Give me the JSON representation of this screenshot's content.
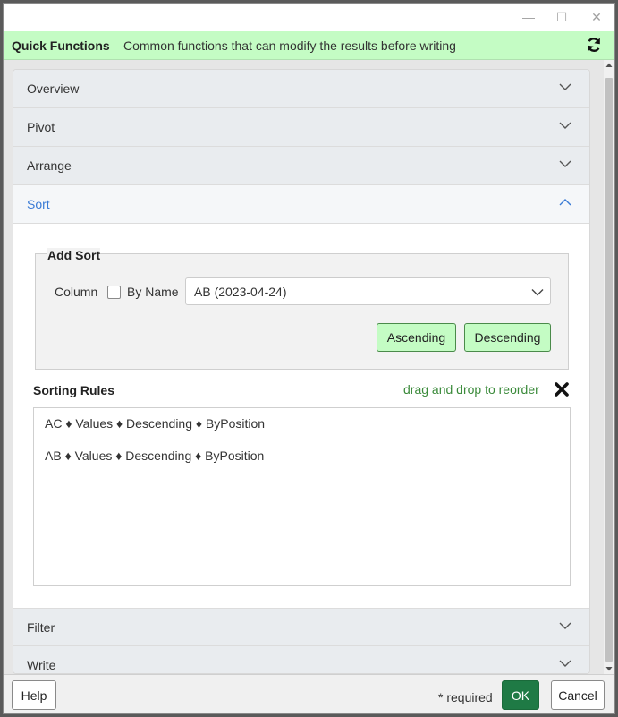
{
  "window": {
    "controls": {
      "minimize": "—",
      "maximize": "☐",
      "close": "✕"
    }
  },
  "quick_functions": {
    "title": "Quick Functions",
    "description": "Common functions that can modify the results before writing"
  },
  "accordion": {
    "overview": "Overview",
    "pivot": "Pivot",
    "arrange": "Arrange",
    "sort": "Sort",
    "filter": "Filter",
    "write": "Write"
  },
  "add_sort": {
    "legend": "Add Sort",
    "column_label": "Column",
    "by_name_label": "By Name",
    "by_name_checked": false,
    "column_value": "AB (2023-04-24)",
    "ascending_label": "Ascending",
    "descending_label": "Descending"
  },
  "sorting_rules": {
    "title": "Sorting Rules",
    "hint": "drag and drop to reorder",
    "rules": [
      "AC ♦ Values ♦ Descending ♦ ByPosition",
      "AB ♦ Values ♦ Descending ♦ ByPosition"
    ]
  },
  "footer": {
    "help_label": "Help",
    "required_label": "* required",
    "ok_label": "OK",
    "cancel_label": "Cancel"
  },
  "colors": {
    "quick_bar": "#c4fcc4",
    "green_button": "#c4fcc4",
    "ok_button": "#1f7a45",
    "active_link": "#3a7bd5",
    "hint_text": "#3a8a3a"
  }
}
